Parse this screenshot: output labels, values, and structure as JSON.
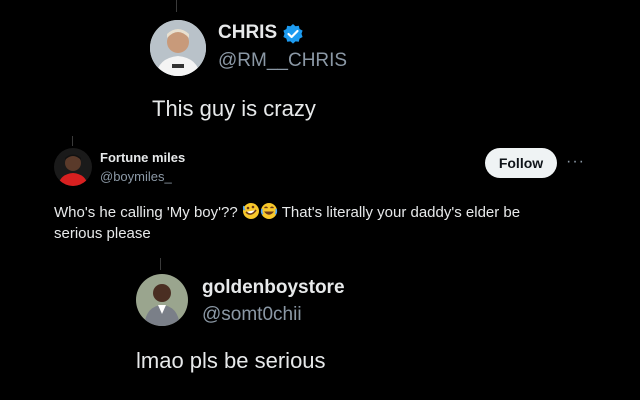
{
  "post1": {
    "name": "CHRIS",
    "handle": "@RM__CHRIS",
    "verified_icon": "verified-badge-icon",
    "text": "This guy is crazy"
  },
  "post2": {
    "name": "Fortune miles",
    "handle": "@boymiles_",
    "follow_label": "Follow",
    "more_label": "···",
    "text_line1_a": "Who's he calling 'My boy'?? ",
    "emojis": [
      "rolling-laughing-emoji",
      "tears-of-joy-emoji"
    ],
    "text_line1_b": " That's literally your daddy's elder be",
    "text_line2": "serious please"
  },
  "post3": {
    "name": "goldenboystore",
    "handle": "@somt0chii",
    "text": "lmao pls be serious"
  },
  "colors": {
    "background": "#000000",
    "text": "#e7e9ea",
    "secondary": "#8b98a5",
    "verified": "#1d9bf0",
    "follow_bg": "#eff3f4"
  }
}
